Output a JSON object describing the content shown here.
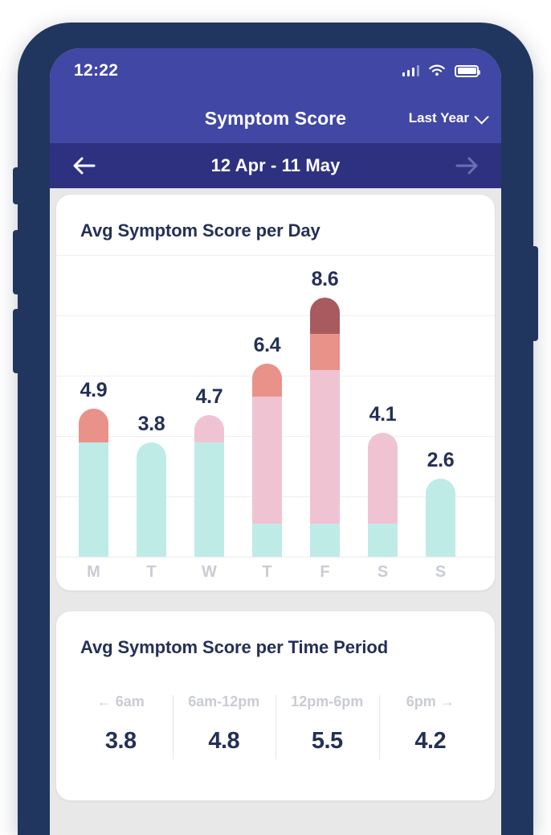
{
  "status_bar": {
    "time": "12:22",
    "signal_icon": "signal-bars-icon",
    "wifi_icon": "wifi-icon",
    "battery_icon": "battery-icon"
  },
  "header": {
    "title": "Symptom Score",
    "period_selector": "Last Year",
    "chevron_icon": "chevron-down-icon"
  },
  "date_nav": {
    "prev_icon": "arrow-left-icon",
    "range": "12 Apr - 11 May",
    "next_icon": "arrow-right-icon"
  },
  "chart_card": {
    "title": "Avg Symptom Score per Day"
  },
  "time_period_card": {
    "title": "Avg Symptom Score per Time Period",
    "cells": [
      {
        "label": "← 6am",
        "value": "3.8"
      },
      {
        "label": "6am-12pm",
        "value": "4.8"
      },
      {
        "label": "12pm-6pm",
        "value": "5.5"
      },
      {
        "label": "6pm →",
        "value": "4.2"
      }
    ]
  },
  "colors": {
    "header_blue": "#4147a5",
    "datebar_blue": "#2e3180",
    "page_bg": "#e8e8e8",
    "card_bg": "#ffffff",
    "text_navy": "#253057",
    "muted_gray": "#c9ccd4",
    "mint": "#bfebe7",
    "pink": "#f0c3d3",
    "salmon": "#e99289",
    "dark_red": "#a85a5f",
    "gridline": "#f0f0f2"
  },
  "chart_data": {
    "type": "bar",
    "title": "Avg Symptom Score per Day",
    "xlabel": "",
    "ylabel": "",
    "ylim": [
      0,
      10
    ],
    "grid": true,
    "legend": "none",
    "stacked": true,
    "categories": [
      "M",
      "T",
      "W",
      "T",
      "F",
      "S",
      "S"
    ],
    "day_labels": [
      "M",
      "T",
      "W",
      "T",
      "F",
      "S",
      "S"
    ],
    "values": [
      4.9,
      3.8,
      4.7,
      6.4,
      8.6,
      4.1,
      2.6
    ],
    "data_labels": [
      "4.9",
      "3.8",
      "4.7",
      "6.4",
      "8.6",
      "4.1",
      "2.6"
    ],
    "series": [
      {
        "name": "mint",
        "color": "#bfebe7",
        "values": [
          3.8,
          3.8,
          3.8,
          1.1,
          1.1,
          1.1,
          2.6
        ]
      },
      {
        "name": "pink",
        "color": "#f0c3d3",
        "values": [
          0,
          0,
          0.9,
          4.2,
          5.1,
          3.0,
          0
        ]
      },
      {
        "name": "salmon",
        "color": "#e99289",
        "values": [
          1.1,
          0,
          0,
          1.1,
          1.2,
          0,
          0
        ]
      },
      {
        "name": "dark_red",
        "color": "#a85a5f",
        "values": [
          0,
          0,
          0,
          0,
          1.2,
          0,
          0
        ]
      }
    ],
    "gridline_values": [
      10,
      8,
      6,
      4,
      2,
      0
    ]
  }
}
